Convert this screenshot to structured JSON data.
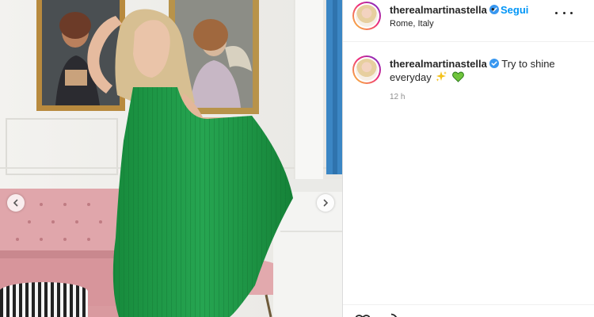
{
  "post": {
    "username": "therealmartinastella",
    "follow_label": "Segui",
    "separator": "•",
    "location": "Rome, Italy",
    "caption": {
      "username": "therealmartinastella",
      "text": "Try to shine everyday",
      "emojis": [
        "sparkles-icon",
        "green-heart-icon"
      ],
      "time": "12 h"
    }
  },
  "colors": {
    "link_blue": "#0095f6",
    "verified_blue": "#3897f0",
    "dress_green": "#1f9a46",
    "sofa_pink": "#d99a9f"
  },
  "icons": {
    "carousel_prev": "chevron-left-icon",
    "carousel_next": "chevron-right-icon",
    "more": "more-options-icon",
    "like": "heart-icon",
    "comment": "comment-icon"
  }
}
